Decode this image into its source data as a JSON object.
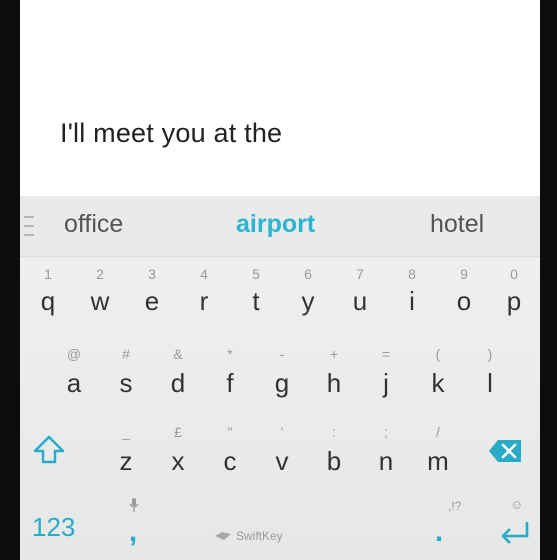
{
  "compose": {
    "text": "I'll meet you at the"
  },
  "predictions": {
    "left": "office",
    "center": "airport",
    "right": "hotel"
  },
  "keyboard": {
    "row1": [
      {
        "key": "q",
        "hint": "1"
      },
      {
        "key": "w",
        "hint": "2"
      },
      {
        "key": "e",
        "hint": "3"
      },
      {
        "key": "r",
        "hint": "4"
      },
      {
        "key": "t",
        "hint": "5"
      },
      {
        "key": "y",
        "hint": "6"
      },
      {
        "key": "u",
        "hint": "7"
      },
      {
        "key": "i",
        "hint": "8"
      },
      {
        "key": "o",
        "hint": "9"
      },
      {
        "key": "p",
        "hint": "0"
      }
    ],
    "row2": [
      {
        "key": "a",
        "hint": "@"
      },
      {
        "key": "s",
        "hint": "#"
      },
      {
        "key": "d",
        "hint": "&"
      },
      {
        "key": "f",
        "hint": "*"
      },
      {
        "key": "g",
        "hint": "-"
      },
      {
        "key": "h",
        "hint": "+"
      },
      {
        "key": "j",
        "hint": "="
      },
      {
        "key": "k",
        "hint": "("
      },
      {
        "key": "l",
        "hint": ")"
      }
    ],
    "row3": [
      {
        "key": "z",
        "hint": "_"
      },
      {
        "key": "x",
        "hint": "£"
      },
      {
        "key": "c",
        "hint": "\""
      },
      {
        "key": "v",
        "hint": "'"
      },
      {
        "key": "b",
        "hint": ":"
      },
      {
        "key": "n",
        "hint": ";"
      },
      {
        "key": "m",
        "hint": "/"
      }
    ],
    "numbers_label": "123",
    "comma": ",",
    "space_label": "SwiftKey",
    "period": ".",
    "punct_hint": ",!?",
    "emoji_hint": "☺"
  },
  "colors": {
    "accent": "#2db4cf",
    "background": "#e9eaea"
  },
  "icons": {
    "shift": "shift-icon",
    "backspace": "backspace-icon",
    "enter": "enter-icon",
    "mic": "mic-icon"
  }
}
